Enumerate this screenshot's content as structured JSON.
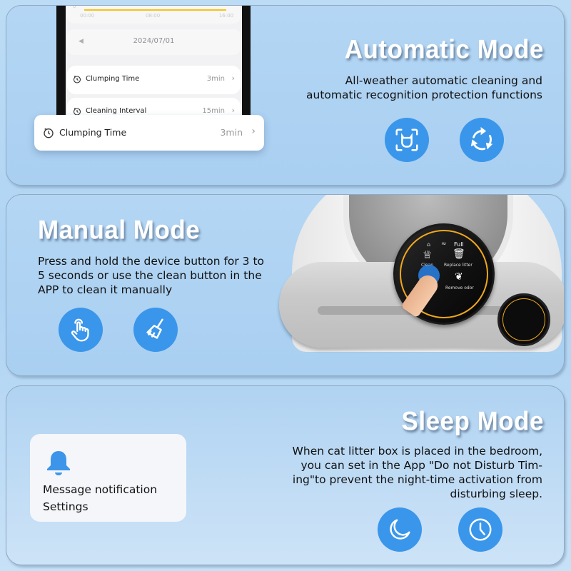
{
  "sections": {
    "automatic": {
      "title": "Automatic Mode",
      "description_lines": [
        "All-weather automatic cleaning and",
        "automatic recognition protection functions"
      ],
      "icons": [
        "cat-face-scan-icon",
        "refresh-cycle-icon"
      ]
    },
    "manual": {
      "title": "Manual Mode",
      "description_lines": [
        "Press and hold the device button for 3 to",
        "5 seconds or use the clean button in the",
        "APP to clean it manually"
      ],
      "icons": [
        "tap-hand-icon",
        "brush-icon"
      ]
    },
    "sleep": {
      "title": "Sleep Mode",
      "description_lines": [
        "When cat litter box is placed in the bedroom,",
        "you can set in the App \"Do not Disturb Tim-",
        "ing\"to prevent the night-time activation from",
        "disturbing sleep."
      ],
      "icons": [
        "moon-icon",
        "clock-icon"
      ]
    }
  },
  "phone_app": {
    "chart_ticks": [
      "00:00",
      "08:00",
      "16:00"
    ],
    "chart_y_label": "0",
    "accent_color": "#f5c518",
    "date": "2024/07/01",
    "rows": [
      {
        "label": "Clumping Time",
        "value": "3min"
      },
      {
        "label": "Cleaning Interval",
        "value": "15min"
      }
    ],
    "highlight_row": {
      "label": "Clumping Time",
      "value": "3min"
    }
  },
  "device_panel": {
    "status": "Full",
    "buttons": [
      "Clean",
      "Replace litter",
      "Remove odor"
    ]
  },
  "notification_card": {
    "line1": "Message notification",
    "line2": "Settings"
  },
  "colors": {
    "icon_blue": "#3a96ea",
    "panel_ring": "#f0a81c"
  }
}
